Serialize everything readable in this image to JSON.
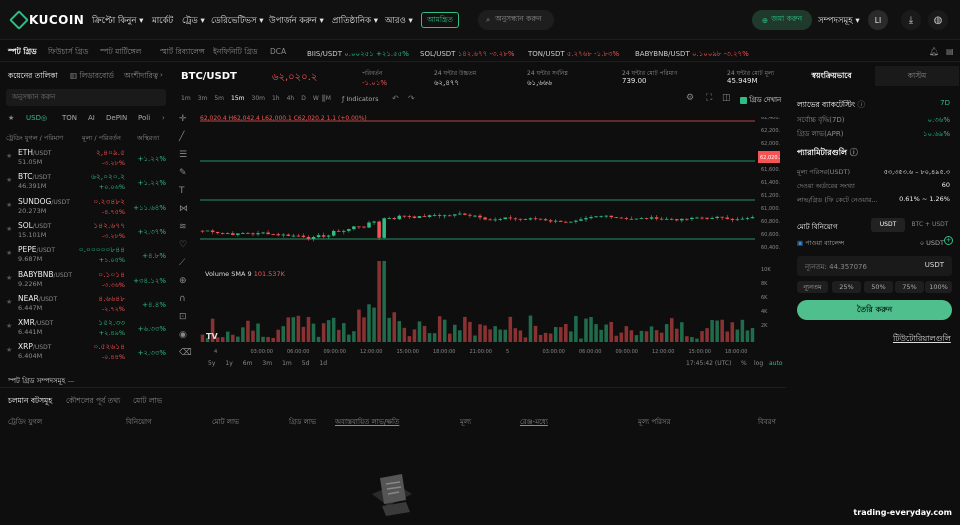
{
  "nav": {
    "brand": "KUCOIN",
    "items": [
      "ক্রিপ্টো কিনুন",
      "মার্কেট",
      "ট্রেড",
      "ডেরিভেটিভস",
      "উপার্জন করুন",
      "প্রাতিষ্ঠানিক",
      "আরও"
    ],
    "badge": "আমন্ত্রিত",
    "search_placeholder": "অনুসন্ধান করুন",
    "deposit": "জমা করুন",
    "assets": "সম্পদসমূহ",
    "avatar": "LI"
  },
  "subtabs": [
    "স্পট গ্রিড",
    "ফিউচার্স গ্রিড",
    "স্পট মার্টিঙ্গেল",
    "স্মার্ট রিব্যালেন্স",
    "ইনফিনিটি গ্রিড",
    "DCA"
  ],
  "tickers": [
    {
      "pair": "BIIS/USDT",
      "price": "০.০০২৫১",
      "change": "+২১.৫৫%",
      "color": "#2fbd85"
    },
    {
      "pair": "SOL/USDT",
      "price": "১৪২.৬৭৭",
      "change": "-৩.২৮%",
      "color": "#f65454"
    },
    {
      "pair": "TON/USDT",
      "price": "৫.২৭৬৮",
      "change": "-১.৮৩%",
      "color": "#f65454"
    },
    {
      "pair": "BABYBNB/USDT",
      "price": "০.১০০৯৮",
      "change": "-৩.২৭%",
      "color": "#f65454"
    }
  ],
  "left": {
    "tab_strategy": "কয়েনের তালিকা",
    "tab_leaderboard": "লিডারবোর্ড",
    "tab_third": "অংশীদারিত্ব",
    "search_placeholder": "অনুসন্ধান করুন",
    "filters": [
      "USD◎",
      "TON",
      "AI",
      "DePIN",
      "Poli"
    ],
    "col1": "ট্রেডিং যুগল / পরিমাণ",
    "col2": "মূল্য / পরিবর্তন",
    "col3": "অস্থিরতা",
    "pairs": [
      {
        "base": "ETH",
        "quote": "/USDT",
        "vol": "51.05M",
        "price": "২,৪০৯.৫",
        "sub": "-৩.২৮%",
        "chg": "+১.২২%",
        "pc": "#f65454",
        "cc": "#2fbd85"
      },
      {
        "base": "BTC",
        "quote": "/USDT",
        "vol": "46.391M",
        "price": "৬২,০২০.২",
        "sub": "+০.০৬%",
        "chg": "+১.২২%",
        "pc": "#2fbd85",
        "cc": "#2fbd85"
      },
      {
        "base": "SUNDOG",
        "quote": "/USDT",
        "vol": "20.273M",
        "price": "০.২৩৪৮২",
        "sub": "-৪.৭৫%",
        "chg": "+১১.৬৪%",
        "pc": "#f65454",
        "cc": "#2fbd85"
      },
      {
        "base": "SOL",
        "quote": "/USDT",
        "vol": "15.101M",
        "price": "১৪২.৬৭৭",
        "sub": "-৩.২৮%",
        "chg": "+২.৩৭%",
        "pc": "#f65454",
        "cc": "#2fbd85"
      },
      {
        "base": "PEPE",
        "quote": "/USDT",
        "vol": "9.687M",
        "price": "০.০০০০০৮৪৪",
        "sub": "+১.০৫%",
        "chg": "+৪.৮%",
        "pc": "#2fbd85",
        "cc": "#2fbd85"
      },
      {
        "base": "BABYBNB",
        "quote": "/USDT",
        "vol": "9.226M",
        "price": "০.১০১৪",
        "sub": "-৩.৩৬%",
        "chg": "+৩৪.১২%",
        "pc": "#f65454",
        "cc": "#2fbd85"
      },
      {
        "base": "NEAR",
        "quote": "/USDT",
        "vol": "6.447M",
        "price": "৪.৬৬৪৮",
        "sub": "-২.৭২%",
        "chg": "+৪.৪%",
        "pc": "#f65454",
        "cc": "#2fbd85"
      },
      {
        "base": "XMR",
        "quote": "/USDT",
        "vol": "6.441M",
        "price": "১৫২.৩৩",
        "sub": "+২.৪৯%",
        "chg": "+৬.৩৩%",
        "pc": "#2fbd85",
        "cc": "#2fbd85"
      },
      {
        "base": "XRP",
        "quote": "/USDT",
        "vol": "6.404M",
        "price": "০.৫২৬১৪",
        "sub": "-০.৪৪%",
        "chg": "+২.৩৩%",
        "pc": "#f65454",
        "cc": "#2fbd85"
      }
    ],
    "spot_grid_assets": "স্পট গ্রিড সম্পদসমূহ"
  },
  "chart": {
    "pair": "BTC/USDT",
    "price": "৬২,০২০.২",
    "stats": [
      {
        "label": "পরিবর্তন",
        "value": "-১.০১%",
        "color": "#f65454"
      },
      {
        "label": "24 ঘন্টার উচ্চতম",
        "value": "৬২,৪৭৭",
        "color": "#e8e8e8"
      },
      {
        "label": "24 ঘন্টার সর্বনিম্ন",
        "value": "৬১,৬৬৬",
        "color": "#e8e8e8"
      },
      {
        "label": "24 ঘন্টার মোট পরিমাণ",
        "value": "739.00",
        "color": "#e8e8e8"
      },
      {
        "label": "24 ঘন্টার মোট মূল্য",
        "value": "45.949M",
        "color": "#e8e8e8"
      }
    ],
    "intervals": [
      "1m",
      "3m",
      "5m",
      "15m",
      "30m",
      "1h",
      "4h",
      "D",
      "W",
      "M"
    ],
    "indicators": "Indicators",
    "grid_toggle": "গ্রিড দেখান",
    "ohlc": "62,020.4  H62,042.4  L62,000.1  C62,020.2  1.1 (+0.00%)",
    "volume_label": "Volume SMA 9",
    "volume_value": "101.537K",
    "price_ticks": [
      "62,400.0",
      "62,200.0",
      "62,000.0",
      "61,800.0",
      "61,600.0",
      "61,400.0",
      "61,200.0",
      "61,000.0",
      "60,800.0",
      "60,600.0",
      "60,400.0"
    ],
    "current_price_tag": "62,020.2",
    "vol_ticks": [
      "10K",
      "8K",
      "6K",
      "4K",
      "2K"
    ],
    "time_ticks": [
      "4",
      "03:00:00",
      "06:00:00",
      "09:00:00",
      "12:00:00",
      "15:00:00",
      "18:00:00",
      "21:00:00",
      "5",
      "03:00:00",
      "06:00:00",
      "09:00:00",
      "12:00:00",
      "15:00:00",
      "18:00:00"
    ],
    "ranges": [
      "5y",
      "1y",
      "6m",
      "3m",
      "1m",
      "5d",
      "1d"
    ],
    "clock": "17:45:42 (UTC)",
    "scale_opts": [
      "%",
      "log",
      "auto"
    ]
  },
  "right": {
    "tab_auto": "স্বয়ংক্রিয়ভাবে",
    "tab_custom": "কাস্টম",
    "backtest_label": "ল্যাভের ব্যাকটেস্টিং",
    "backtest_value": "7D",
    "annual_label": "সর্বোচ্চ বৃদ্ধি(7D)",
    "annual_value": "০.৩৬%",
    "apr_label": "গ্রিড লাভ(APR)",
    "apr_value": "১০.৬৯%",
    "params_title": "প্যারামিটারগুলি",
    "price_range_label": "মূল্য পরিসর(USDT)",
    "price_range_value": "৫৩,৩৫৩.৬ – ৮০,৪৯৫.৩",
    "grids_label": "দেওয়া অর্ডারের সংখ্যা",
    "grids_value": "60",
    "profit_label": "লাভ/গ্রিড (ফি কেটে নেওয়ার...",
    "profit_value": "0.61% ~ 1.26%",
    "invest_label": "মোট বিনিয়োগ",
    "invest_tab1": "USDT",
    "invest_tab2": "BTC + USDT",
    "balance_label": "পাওয়া ব্যালেন্স",
    "balance_value": "০ USDT",
    "min_placeholder": "ন্যূনতম: 44.357076",
    "min_unit": "USDT",
    "pcts": [
      "ন্যূনতম",
      "25%",
      "50%",
      "75%",
      "100%"
    ],
    "create": "তৈরি করুন",
    "tutorial": "টিউটোরিয়ালগুলি"
  },
  "bottom": {
    "tabs": [
      "চলমান বটসমূহ",
      "কৌশলের পূর্ব তথ্য",
      "মোট লাভ"
    ],
    "headers": [
      "ট্রেডিং যুগল",
      "বিনিয়োগ",
      "মোট লাভ",
      "গ্রিড লাভ",
      "অবাস্তবায়িত লাভ/ক্ষতি",
      "মূল্য",
      "রেঞ্জ-মধ্যে",
      "মূল্য পরিসর",
      "বিবরণ"
    ]
  },
  "watermark": "trading-everyday.com",
  "colors": {
    "accent": "#2fbd85",
    "down": "#f65454",
    "bg": "#0e0e0e"
  }
}
